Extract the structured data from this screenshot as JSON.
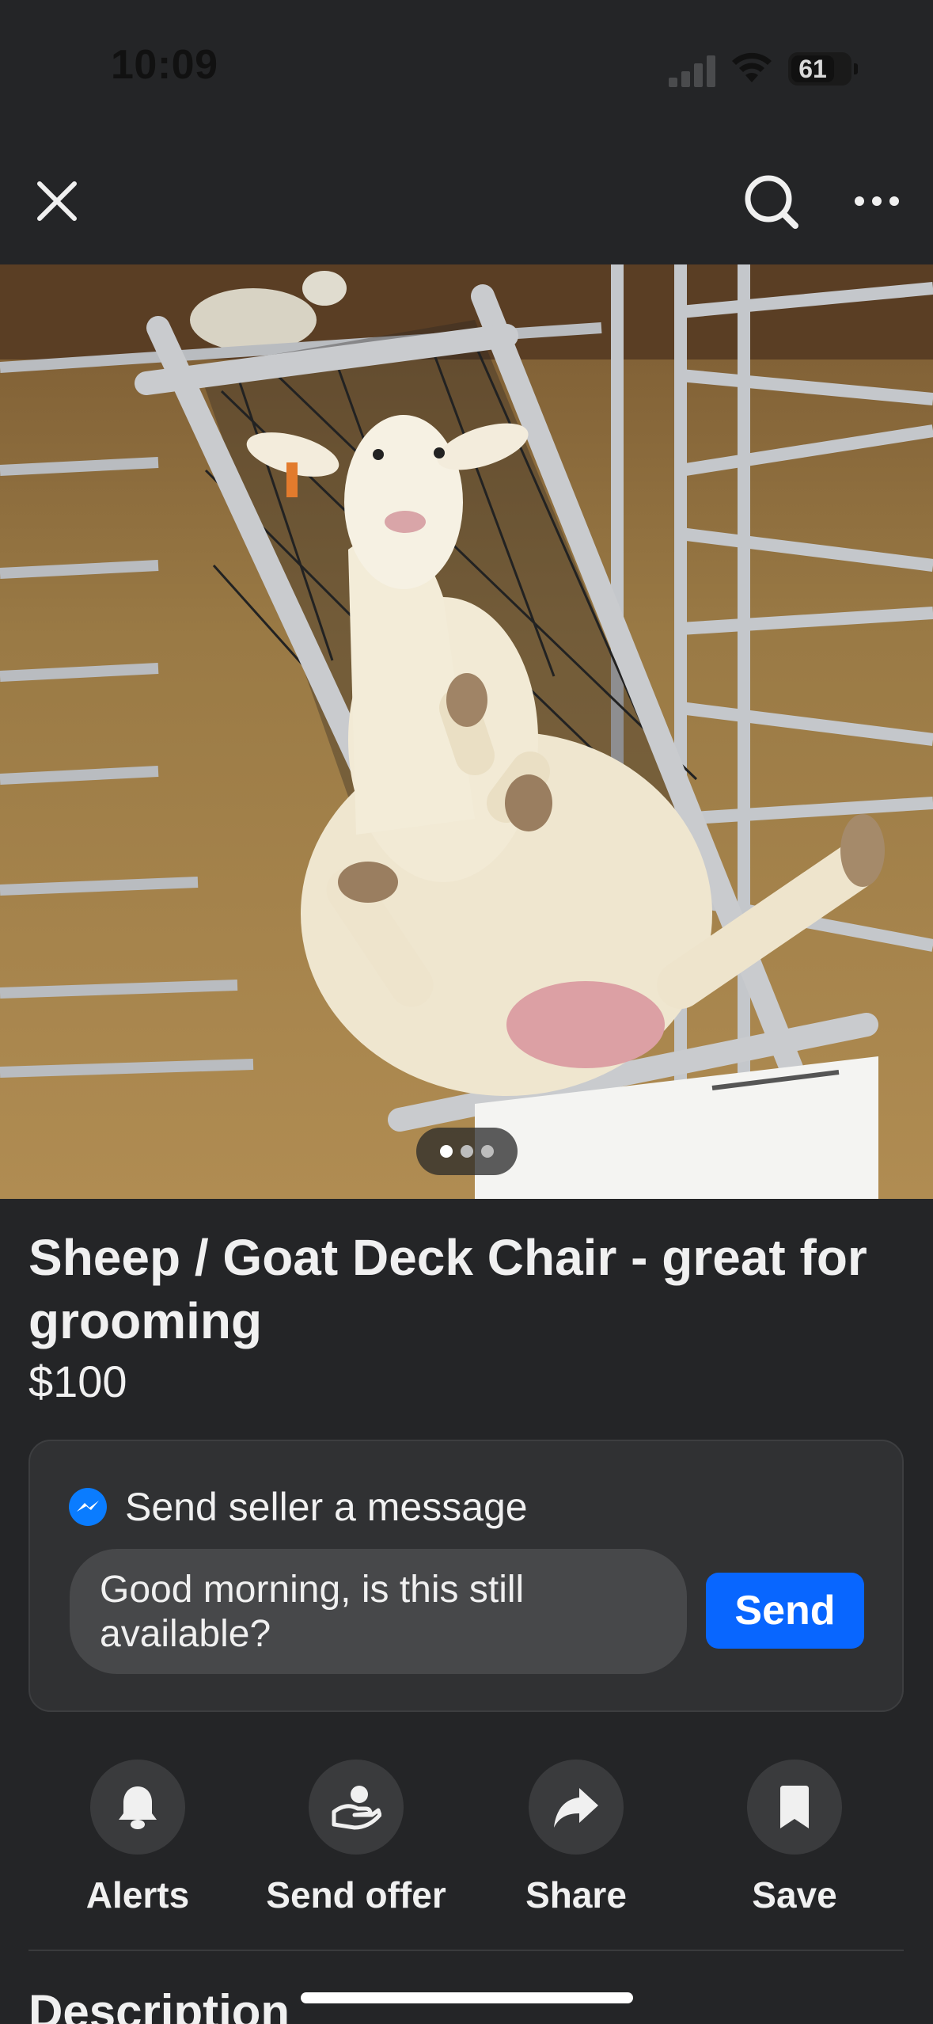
{
  "status_bar": {
    "time": "10:09",
    "battery": "61"
  },
  "nav": {
    "close_icon": "close-icon",
    "search_icon": "search-icon",
    "more_icon": "more-icon"
  },
  "photo": {
    "carousel_pages": 3,
    "active_page": 1
  },
  "listing": {
    "title": "Sheep / Goat Deck Chair - great for grooming",
    "price": "$100"
  },
  "message": {
    "header": "Send seller a message",
    "input_value": "Good morning, is this still available?",
    "send_label": "Send"
  },
  "actions": [
    {
      "label": "Alerts",
      "icon": "bell-icon"
    },
    {
      "label": "Send offer",
      "icon": "offer-icon"
    },
    {
      "label": "Share",
      "icon": "share-icon"
    },
    {
      "label": "Save",
      "icon": "bookmark-icon"
    }
  ],
  "description": {
    "heading": "Description"
  },
  "colors": {
    "background": "#242527",
    "accent": "#0866ff",
    "card": "#303133"
  }
}
